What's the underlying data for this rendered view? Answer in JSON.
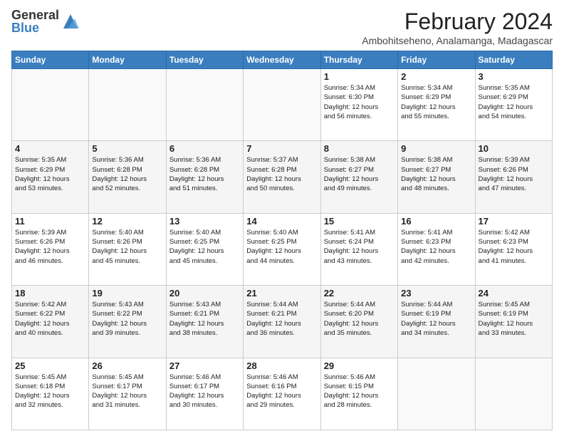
{
  "logo": {
    "general": "General",
    "blue": "Blue"
  },
  "title": "February 2024",
  "subtitle": "Ambohitseheno, Analamanga, Madagascar",
  "days_of_week": [
    "Sunday",
    "Monday",
    "Tuesday",
    "Wednesday",
    "Thursday",
    "Friday",
    "Saturday"
  ],
  "weeks": [
    [
      {
        "day": "",
        "info": ""
      },
      {
        "day": "",
        "info": ""
      },
      {
        "day": "",
        "info": ""
      },
      {
        "day": "",
        "info": ""
      },
      {
        "day": "1",
        "info": "Sunrise: 5:34 AM\nSunset: 6:30 PM\nDaylight: 12 hours\nand 56 minutes."
      },
      {
        "day": "2",
        "info": "Sunrise: 5:34 AM\nSunset: 6:29 PM\nDaylight: 12 hours\nand 55 minutes."
      },
      {
        "day": "3",
        "info": "Sunrise: 5:35 AM\nSunset: 6:29 PM\nDaylight: 12 hours\nand 54 minutes."
      }
    ],
    [
      {
        "day": "4",
        "info": "Sunrise: 5:35 AM\nSunset: 6:29 PM\nDaylight: 12 hours\nand 53 minutes."
      },
      {
        "day": "5",
        "info": "Sunrise: 5:36 AM\nSunset: 6:28 PM\nDaylight: 12 hours\nand 52 minutes."
      },
      {
        "day": "6",
        "info": "Sunrise: 5:36 AM\nSunset: 6:28 PM\nDaylight: 12 hours\nand 51 minutes."
      },
      {
        "day": "7",
        "info": "Sunrise: 5:37 AM\nSunset: 6:28 PM\nDaylight: 12 hours\nand 50 minutes."
      },
      {
        "day": "8",
        "info": "Sunrise: 5:38 AM\nSunset: 6:27 PM\nDaylight: 12 hours\nand 49 minutes."
      },
      {
        "day": "9",
        "info": "Sunrise: 5:38 AM\nSunset: 6:27 PM\nDaylight: 12 hours\nand 48 minutes."
      },
      {
        "day": "10",
        "info": "Sunrise: 5:39 AM\nSunset: 6:26 PM\nDaylight: 12 hours\nand 47 minutes."
      }
    ],
    [
      {
        "day": "11",
        "info": "Sunrise: 5:39 AM\nSunset: 6:26 PM\nDaylight: 12 hours\nand 46 minutes."
      },
      {
        "day": "12",
        "info": "Sunrise: 5:40 AM\nSunset: 6:26 PM\nDaylight: 12 hours\nand 45 minutes."
      },
      {
        "day": "13",
        "info": "Sunrise: 5:40 AM\nSunset: 6:25 PM\nDaylight: 12 hours\nand 45 minutes."
      },
      {
        "day": "14",
        "info": "Sunrise: 5:40 AM\nSunset: 6:25 PM\nDaylight: 12 hours\nand 44 minutes."
      },
      {
        "day": "15",
        "info": "Sunrise: 5:41 AM\nSunset: 6:24 PM\nDaylight: 12 hours\nand 43 minutes."
      },
      {
        "day": "16",
        "info": "Sunrise: 5:41 AM\nSunset: 6:23 PM\nDaylight: 12 hours\nand 42 minutes."
      },
      {
        "day": "17",
        "info": "Sunrise: 5:42 AM\nSunset: 6:23 PM\nDaylight: 12 hours\nand 41 minutes."
      }
    ],
    [
      {
        "day": "18",
        "info": "Sunrise: 5:42 AM\nSunset: 6:22 PM\nDaylight: 12 hours\nand 40 minutes."
      },
      {
        "day": "19",
        "info": "Sunrise: 5:43 AM\nSunset: 6:22 PM\nDaylight: 12 hours\nand 39 minutes."
      },
      {
        "day": "20",
        "info": "Sunrise: 5:43 AM\nSunset: 6:21 PM\nDaylight: 12 hours\nand 38 minutes."
      },
      {
        "day": "21",
        "info": "Sunrise: 5:44 AM\nSunset: 6:21 PM\nDaylight: 12 hours\nand 36 minutes."
      },
      {
        "day": "22",
        "info": "Sunrise: 5:44 AM\nSunset: 6:20 PM\nDaylight: 12 hours\nand 35 minutes."
      },
      {
        "day": "23",
        "info": "Sunrise: 5:44 AM\nSunset: 6:19 PM\nDaylight: 12 hours\nand 34 minutes."
      },
      {
        "day": "24",
        "info": "Sunrise: 5:45 AM\nSunset: 6:19 PM\nDaylight: 12 hours\nand 33 minutes."
      }
    ],
    [
      {
        "day": "25",
        "info": "Sunrise: 5:45 AM\nSunset: 6:18 PM\nDaylight: 12 hours\nand 32 minutes."
      },
      {
        "day": "26",
        "info": "Sunrise: 5:45 AM\nSunset: 6:17 PM\nDaylight: 12 hours\nand 31 minutes."
      },
      {
        "day": "27",
        "info": "Sunrise: 5:46 AM\nSunset: 6:17 PM\nDaylight: 12 hours\nand 30 minutes."
      },
      {
        "day": "28",
        "info": "Sunrise: 5:46 AM\nSunset: 6:16 PM\nDaylight: 12 hours\nand 29 minutes."
      },
      {
        "day": "29",
        "info": "Sunrise: 5:46 AM\nSunset: 6:15 PM\nDaylight: 12 hours\nand 28 minutes."
      },
      {
        "day": "",
        "info": ""
      },
      {
        "day": "",
        "info": ""
      }
    ]
  ]
}
